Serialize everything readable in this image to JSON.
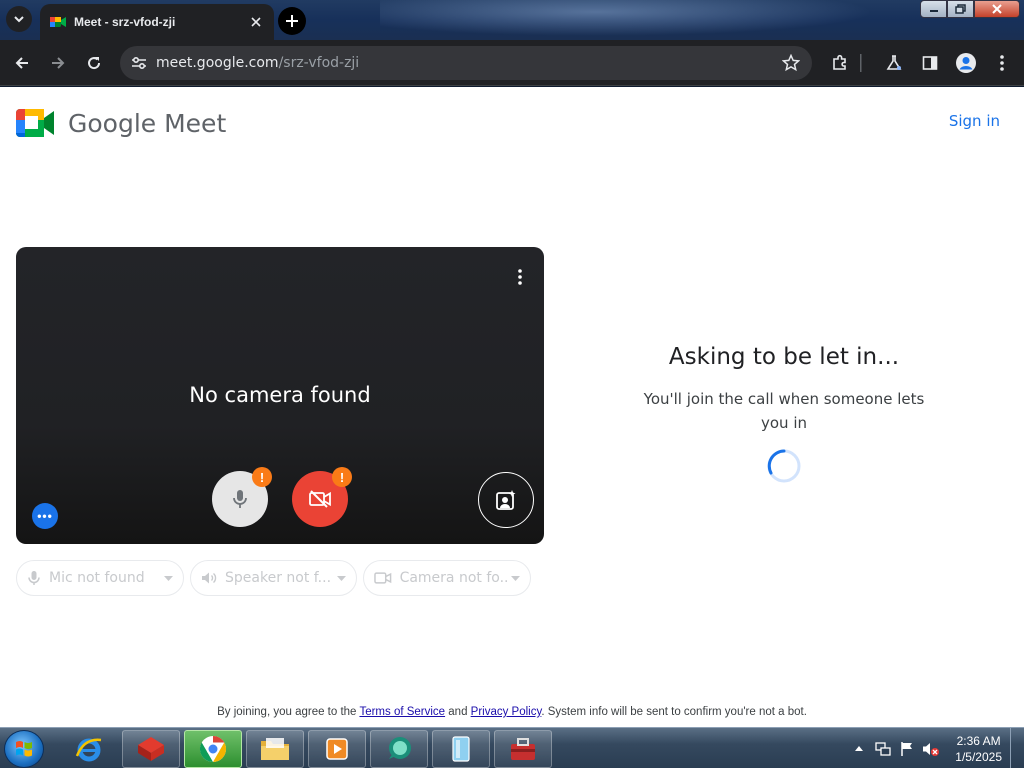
{
  "browser": {
    "tab": {
      "title": "Meet - srz-vfod-zji"
    },
    "address": {
      "domain": "meet.google.com",
      "path": "/srz-vfod-zji"
    }
  },
  "header": {
    "logo_text": "Google Meet",
    "sign_in_label": "Sign in"
  },
  "preview": {
    "status_text": "No camera found",
    "mic_warning": "!",
    "cam_warning": "!",
    "more_label": "•••"
  },
  "devices": [
    {
      "label": "Mic not found",
      "icon": "mic-icon"
    },
    {
      "label": "Speaker not f...",
      "icon": "speaker-icon"
    },
    {
      "label": "Camera not fo...",
      "icon": "camera-icon"
    }
  ],
  "join_status": {
    "title": "Asking to be let in...",
    "subtitle": "You'll join the call when someone lets you in"
  },
  "legal": {
    "prefix": "By joining, you agree to the ",
    "terms_label": "Terms of Service",
    "middle": " and ",
    "privacy_label": "Privacy Policy",
    "suffix": ". System info will be sent to confirm you're not a bot."
  },
  "taskbar": {
    "clock_time": "2:36 AM",
    "clock_date": "1/5/2025"
  },
  "colors": {
    "accent_blue": "#1a73e8",
    "cam_off_red": "#ea4335",
    "warning_orange": "#fa7b17",
    "chrome_dark": "#202124"
  }
}
